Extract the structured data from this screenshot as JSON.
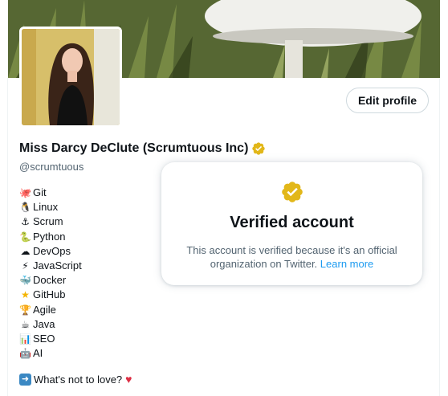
{
  "profile": {
    "edit_button": "Edit profile",
    "name": "Miss Darcy DeClute (Scrumtuous Inc)",
    "handle": "@scrumtuous",
    "verified_badge_color": "#e2b719"
  },
  "bio": {
    "items": [
      {
        "icon": "octopus-icon",
        "glyph": "🐙",
        "label": "Git"
      },
      {
        "icon": "penguin-icon",
        "glyph": "🐧",
        "label": "Linux"
      },
      {
        "icon": "anchor-icon",
        "glyph": "⚓",
        "label": "Scrum"
      },
      {
        "icon": "snake-icon",
        "glyph": "🐍",
        "label": "Python"
      },
      {
        "icon": "cloud-icon",
        "glyph": "☁",
        "label": "DevOps"
      },
      {
        "icon": "lightning-icon",
        "glyph": "⚡",
        "label": "JavaScript"
      },
      {
        "icon": "whale-icon",
        "glyph": "🐳",
        "label": "Docker"
      },
      {
        "icon": "star-icon",
        "glyph": "★",
        "label": "GitHub"
      },
      {
        "icon": "trophy-icon",
        "glyph": "🏆",
        "label": "Agile"
      },
      {
        "icon": "coffee-icon",
        "glyph": "☕",
        "label": "Java"
      },
      {
        "icon": "bar-chart-icon",
        "glyph": "📊",
        "label": "SEO"
      },
      {
        "icon": "robot-icon",
        "glyph": "🤖",
        "label": "AI"
      }
    ],
    "closing": "What's not to love?",
    "closing_icon": "right-arrow-icon",
    "heart_icon": "red-heart-icon"
  },
  "verified_card": {
    "title": "Verified account",
    "body": "This account is verified because it's an official organization on Twitter.",
    "link": "Learn more"
  },
  "colors": {
    "link": "#1d9bf0",
    "muted_text": "#536471",
    "primary_text": "#0f1419",
    "heart": "#dd2e44"
  }
}
